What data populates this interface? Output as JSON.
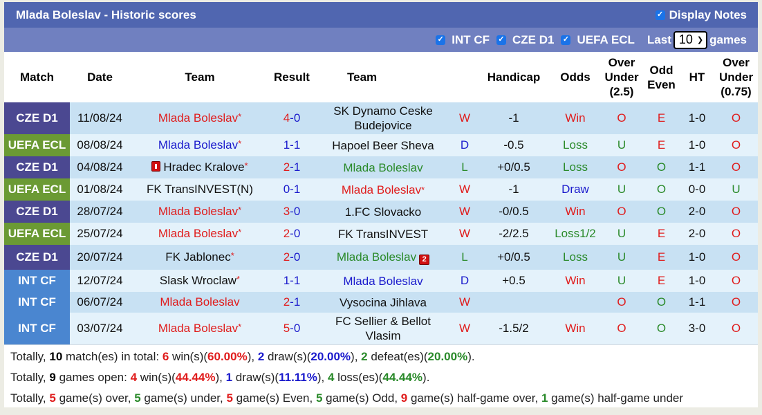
{
  "header": {
    "title": "Mlada Boleslav - Historic scores",
    "display_notes_label": "Display Notes",
    "display_notes_checked": true
  },
  "filters": {
    "competitions": [
      {
        "label": "INT CF",
        "checked": true
      },
      {
        "label": "CZE D1",
        "checked": true
      },
      {
        "label": "UEFA ECL",
        "checked": true
      }
    ],
    "last_label": "Last",
    "last_value": "10",
    "games_label": "games"
  },
  "columns": [
    "Match",
    "Date",
    "Team",
    "Result",
    "Team",
    "Handicap",
    "Odds",
    "Over Under (2.5)",
    "Odd Even",
    "HT",
    "Over Under (0.75)"
  ],
  "column_lines": {
    "ou25": [
      "Over",
      "Under",
      "(2.5)"
    ],
    "oe": [
      "Odd",
      "Even"
    ],
    "ou075": [
      "Over",
      "Under",
      "(0.75)"
    ]
  },
  "comp_colors": {
    "CZE D1": "#4b4891",
    "UEFA ECL": "#6b9a34",
    "INT CF": "#4a86d0"
  },
  "rows": [
    {
      "comp": "CZE D1",
      "date": "11/08/24",
      "home": "Mlada Boleslav",
      "home_star": true,
      "home_color": "red",
      "home_card": "",
      "score_h": "4",
      "score_a": "0",
      "score_color": "red",
      "away": "SK Dynamo Ceske Budejovice",
      "away_star": false,
      "away_color": "black",
      "away_card": "",
      "res": "W",
      "handicap": "-1",
      "odds": "Win",
      "ou": "O",
      "oe": "E",
      "ht": "1-0",
      "ou2": "O"
    },
    {
      "comp": "UEFA ECL",
      "date": "08/08/24",
      "home": "Mlada Boleslav",
      "home_star": true,
      "home_color": "blue",
      "home_card": "",
      "score_h": "1",
      "score_a": "1",
      "score_color": "blue",
      "away": "Hapoel Beer Sheva",
      "away_star": false,
      "away_color": "black",
      "away_card": "",
      "res": "D",
      "handicap": "-0.5",
      "odds": "Loss",
      "ou": "U",
      "oe": "E",
      "ht": "1-0",
      "ou2": "O"
    },
    {
      "comp": "CZE D1",
      "date": "04/08/24",
      "home": "Hradec Kralove",
      "home_star": true,
      "home_color": "black",
      "home_card": "1",
      "score_h": "2",
      "score_a": "1",
      "score_color": "red",
      "away": "Mlada Boleslav",
      "away_star": false,
      "away_color": "green",
      "away_card": "",
      "res": "L",
      "handicap": "+0/0.5",
      "odds": "Loss",
      "ou": "O",
      "oe": "O",
      "ht": "1-1",
      "ou2": "O"
    },
    {
      "comp": "UEFA ECL",
      "date": "01/08/24",
      "home": "FK TransINVEST(N)",
      "home_star": false,
      "home_color": "black",
      "home_card": "",
      "score_h": "0",
      "score_a": "1",
      "score_color": "blue",
      "away": "Mlada Boleslav",
      "away_star": true,
      "away_color": "red",
      "away_card": "",
      "res": "W",
      "handicap": "-1",
      "odds": "Draw",
      "ou": "U",
      "oe": "O",
      "ht": "0-0",
      "ou2": "U"
    },
    {
      "comp": "CZE D1",
      "date": "28/07/24",
      "home": "Mlada Boleslav",
      "home_star": true,
      "home_color": "red",
      "home_card": "",
      "score_h": "3",
      "score_a": "0",
      "score_color": "red",
      "away": "1.FC Slovacko",
      "away_star": false,
      "away_color": "black",
      "away_card": "",
      "res": "W",
      "handicap": "-0/0.5",
      "odds": "Win",
      "ou": "O",
      "oe": "O",
      "ht": "2-0",
      "ou2": "O"
    },
    {
      "comp": "UEFA ECL",
      "date": "25/07/24",
      "home": "Mlada Boleslav",
      "home_star": true,
      "home_color": "red",
      "home_card": "",
      "score_h": "2",
      "score_a": "0",
      "score_color": "red",
      "away": "FK TransINVEST",
      "away_star": false,
      "away_color": "black",
      "away_card": "",
      "res": "W",
      "handicap": "-2/2.5",
      "odds": "Loss1/2",
      "ou": "U",
      "oe": "E",
      "ht": "2-0",
      "ou2": "O"
    },
    {
      "comp": "CZE D1",
      "date": "20/07/24",
      "home": "FK Jablonec",
      "home_star": true,
      "home_color": "black",
      "home_card": "",
      "score_h": "2",
      "score_a": "0",
      "score_color": "red",
      "away": "Mlada Boleslav",
      "away_star": false,
      "away_color": "green",
      "away_card": "2",
      "res": "L",
      "handicap": "+0/0.5",
      "odds": "Loss",
      "ou": "U",
      "oe": "E",
      "ht": "1-0",
      "ou2": "O"
    },
    {
      "comp": "INT CF",
      "date": "12/07/24",
      "home": "Slask Wroclaw",
      "home_star": true,
      "home_color": "black",
      "home_card": "",
      "score_h": "1",
      "score_a": "1",
      "score_color": "blue",
      "away": "Mlada Boleslav",
      "away_star": false,
      "away_color": "blue",
      "away_card": "",
      "res": "D",
      "handicap": "+0.5",
      "odds": "Win",
      "ou": "U",
      "oe": "E",
      "ht": "1-0",
      "ou2": "O"
    },
    {
      "comp": "INT CF",
      "date": "06/07/24",
      "home": "Mlada Boleslav",
      "home_star": false,
      "home_color": "red",
      "home_card": "",
      "score_h": "2",
      "score_a": "1",
      "score_color": "red",
      "away": "Vysocina Jihlava",
      "away_star": false,
      "away_color": "black",
      "away_card": "",
      "res": "W",
      "handicap": "",
      "odds": "",
      "ou": "O",
      "oe": "O",
      "ht": "1-1",
      "ou2": "O"
    },
    {
      "comp": "INT CF",
      "date": "03/07/24",
      "home": "Mlada Boleslav",
      "home_star": true,
      "home_color": "red",
      "home_card": "",
      "score_h": "5",
      "score_a": "0",
      "score_color": "red",
      "away": "FC Sellier & Bellot Vlasim",
      "away_star": false,
      "away_color": "black",
      "away_card": "",
      "res": "W",
      "handicap": "-1.5/2",
      "odds": "Win",
      "ou": "O",
      "oe": "O",
      "ht": "3-0",
      "ou2": "O"
    }
  ],
  "summary": [
    [
      {
        "t": "Totally, "
      },
      {
        "t": "10",
        "c": "black",
        "b": true
      },
      {
        "t": " match(es) in total: "
      },
      {
        "t": "6",
        "c": "red",
        "b": true
      },
      {
        "t": " win(s)("
      },
      {
        "t": "60.00%",
        "c": "red",
        "b": true
      },
      {
        "t": "), "
      },
      {
        "t": "2",
        "c": "blue",
        "b": true
      },
      {
        "t": " draw(s)("
      },
      {
        "t": "20.00%",
        "c": "blue",
        "b": true
      },
      {
        "t": "), "
      },
      {
        "t": "2",
        "c": "green",
        "b": true
      },
      {
        "t": " defeat(es)("
      },
      {
        "t": "20.00%",
        "c": "green",
        "b": true
      },
      {
        "t": ")."
      }
    ],
    [
      {
        "t": "Totally, "
      },
      {
        "t": "9",
        "c": "black",
        "b": true
      },
      {
        "t": " games open: "
      },
      {
        "t": "4",
        "c": "red",
        "b": true
      },
      {
        "t": " win(s)("
      },
      {
        "t": "44.44%",
        "c": "red",
        "b": true
      },
      {
        "t": "), "
      },
      {
        "t": "1",
        "c": "blue",
        "b": true
      },
      {
        "t": " draw(s)("
      },
      {
        "t": "11.11%",
        "c": "blue",
        "b": true
      },
      {
        "t": "), "
      },
      {
        "t": "4",
        "c": "green",
        "b": true
      },
      {
        "t": " loss(es)("
      },
      {
        "t": "44.44%",
        "c": "green",
        "b": true
      },
      {
        "t": ")."
      }
    ],
    [
      {
        "t": "Totally, "
      },
      {
        "t": "5",
        "c": "red",
        "b": true
      },
      {
        "t": " game(s) over, "
      },
      {
        "t": "5",
        "c": "green",
        "b": true
      },
      {
        "t": " game(s) under, "
      },
      {
        "t": "5",
        "c": "red",
        "b": true
      },
      {
        "t": " game(s) Even, "
      },
      {
        "t": "5",
        "c": "green",
        "b": true
      },
      {
        "t": " game(s) Odd, "
      },
      {
        "t": "9",
        "c": "red",
        "b": true
      },
      {
        "t": " game(s) half-game over, "
      },
      {
        "t": "1",
        "c": "green",
        "b": true
      },
      {
        "t": " game(s) half-game under"
      }
    ]
  ]
}
